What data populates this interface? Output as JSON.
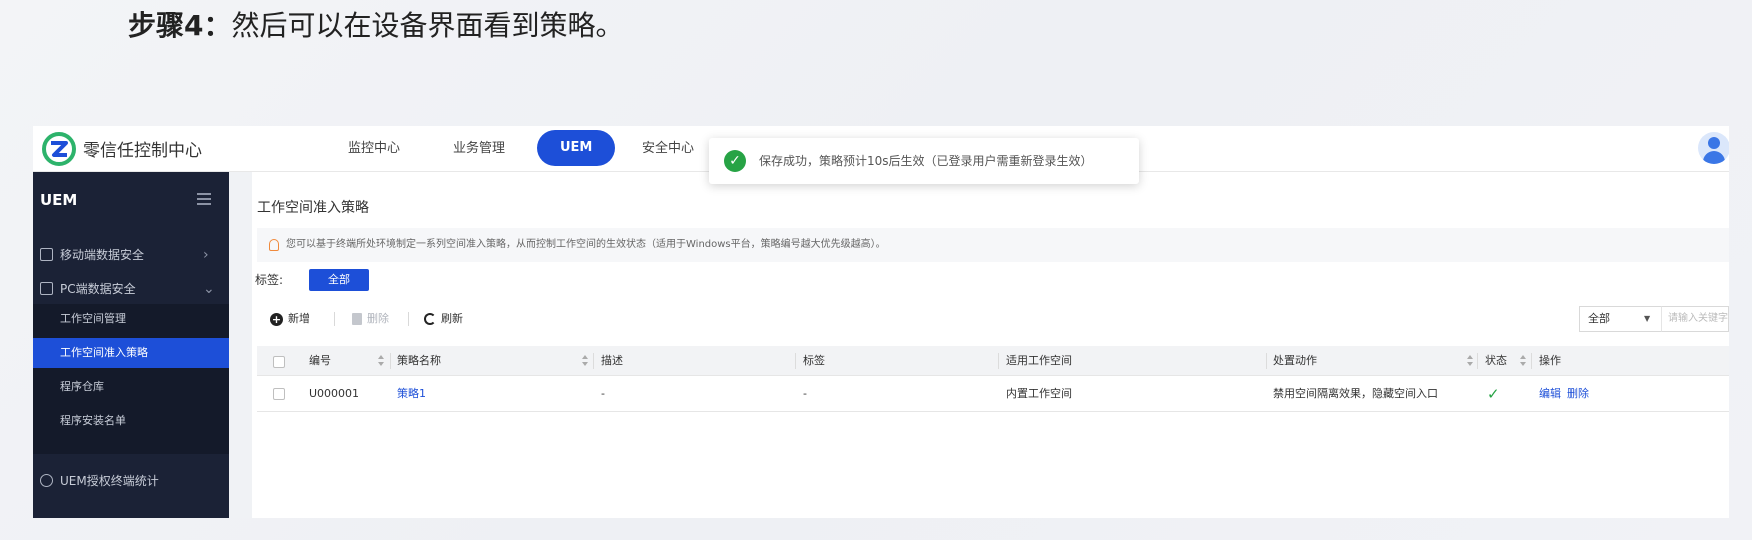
{
  "caption": {
    "step_label": "步骤4：",
    "text": "然后可以在设备界面看到策略。"
  },
  "app": {
    "brand": "零信任控制中心",
    "nav": [
      "监控中心",
      "业务管理",
      "UEM",
      "安全中心"
    ],
    "active_nav": "UEM"
  },
  "toast": {
    "message": "保存成功，策略预计10s后生效（已登录用户需重新登录生效）",
    "status_color": "#27a345"
  },
  "sidebar": {
    "title": "UEM",
    "items": [
      {
        "label": "移动端数据安全",
        "icon": "mobile-icon",
        "chevron": "›"
      },
      {
        "label": "PC端数据安全",
        "icon": "monitor-icon",
        "chevron": "⌄"
      },
      {
        "label": "UEM授权终端统计",
        "icon": "clock-icon"
      }
    ],
    "sub_items": [
      "工作空间管理",
      "工作空间准入策略",
      "程序仓库",
      "程序安装名单"
    ],
    "active_sub": "工作空间准入策略"
  },
  "main": {
    "title": "工作空间准入策略",
    "tip": "您可以基于终端所处环境制定一系列空间准入策略，从而控制工作空间的生效状态（适用于Windows平台，策略编号越大优先级越高）。",
    "tag_label": "标签:",
    "tag_value": "全部",
    "toolbar": {
      "add": "新增",
      "delete": "删除",
      "refresh": "刷新"
    },
    "filter": {
      "selected": "全部",
      "search_placeholder": "请输入关键字"
    },
    "table": {
      "columns": [
        "编号",
        "策略名称",
        "描述",
        "标签",
        "适用工作空间",
        "处置动作",
        "状态",
        "操作"
      ],
      "rows": [
        {
          "id": "U000001",
          "name": "策略1",
          "desc": "-",
          "tag": "-",
          "workspace": "内置工作空间",
          "action": "禁用空间隔离效果，隐藏空间入口",
          "status": "✓",
          "ops": [
            "编辑",
            "删除"
          ]
        }
      ]
    }
  },
  "colors": {
    "primary": "#1d4fd8",
    "sidebar_bg": "#1b2236",
    "success": "#27a345"
  }
}
